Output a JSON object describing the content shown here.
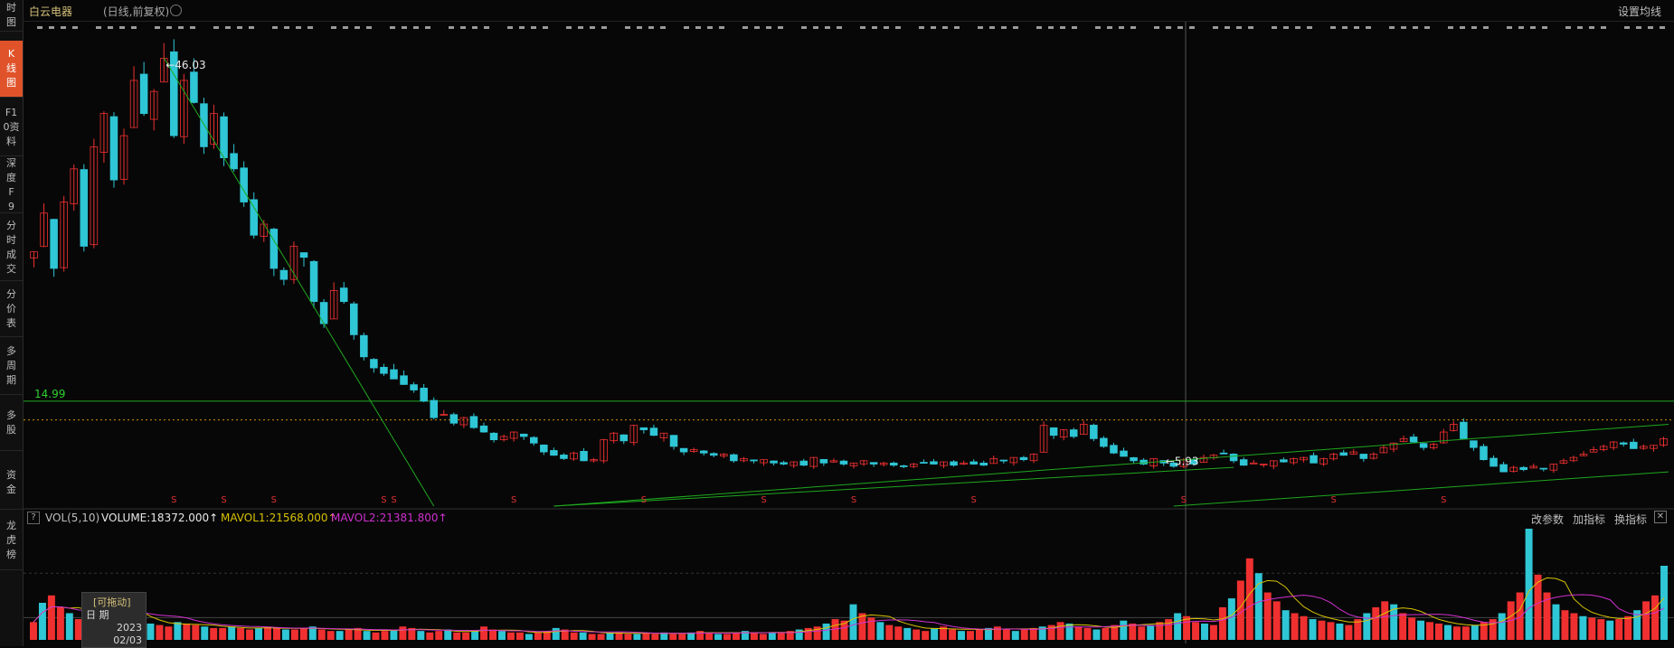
{
  "sidebar": {
    "items": [
      {
        "label": "时图",
        "active": false
      },
      {
        "label": "K线图",
        "active": true
      },
      {
        "label": "F10资料",
        "active": false
      },
      {
        "label": "深度F9",
        "active": false
      },
      {
        "label": "分时成交",
        "active": false
      },
      {
        "label": "分价表",
        "active": false
      },
      {
        "label": "多周期",
        "active": false
      },
      {
        "label": "多股",
        "active": false
      },
      {
        "label": "资金",
        "active": false
      },
      {
        "label": "龙虎榜",
        "active": false
      }
    ]
  },
  "header": {
    "title": "白云电器",
    "subtitle": "(日线,前复权)",
    "settings_label": "设置均线"
  },
  "chart_data": {
    "type": "candlestick",
    "price_annotations": {
      "high": "46.03",
      "low": "5.93",
      "level": "14.99"
    },
    "ylim_price": [
      5.5,
      48
    ],
    "price_series": [
      28.5,
      32,
      27,
      33,
      36,
      29,
      38,
      41,
      35,
      39,
      44,
      41,
      43,
      46,
      39,
      44,
      42,
      38,
      41,
      37,
      36,
      33,
      30,
      31,
      27,
      26,
      29,
      28,
      24,
      22,
      25,
      24,
      21,
      19,
      18,
      17.5,
      17,
      16.5,
      16,
      15,
      13.5,
      13.8,
      13,
      13.5,
      12.6,
      12.2,
      11.5,
      11.8,
      12.2,
      11.8,
      11.2,
      10.4,
      10.1,
      9.8,
      10.3,
      9.6,
      9.7,
      11.5,
      12.1,
      11.4,
      12.8,
      12.4,
      11.9,
      12.1,
      10.9,
      10.4,
      10.6,
      10.3,
      10.1,
      10.2,
      9.6,
      9.8,
      9.6,
      9.7,
      9.4,
      9.3,
      9.5,
      9.2,
      9.9,
      9.4,
      9.6,
      9.3,
      9.4,
      9.6,
      9.3,
      9.4,
      9.2,
      9.1,
      9.3,
      9.4,
      9.3,
      9.5,
      9.2,
      9.4,
      9.3,
      9.2,
      9.8,
      9.6,
      9.9,
      9.7,
      10.2,
      12.8,
      11.9,
      12.4,
      11.8,
      12.9,
      11.6,
      10.9,
      10.3,
      10.0,
      9.6,
      9.3,
      9.8,
      9.4,
      9.1,
      9.7,
      9.3,
      9.9,
      10.1,
      10.3,
      9.6,
      9.2,
      9.4,
      9.3,
      9.6,
      9.5,
      9.8,
      9.9,
      9.4,
      9.8,
      10.2,
      10.1,
      10.4,
      9.8,
      10.2,
      10.8,
      11.2,
      11.6,
      11.3,
      10.8,
      11.1,
      12.2,
      12.9,
      11.6,
      10.8,
      9.7,
      9.1,
      8.6,
      9.0,
      8.8,
      9.1,
      8.9,
      9.3,
      9.6,
      9.9,
      10.2,
      10.6,
      10.9,
      11.3,
      11.1,
      10.7,
      10.9,
      11.0,
      11.6
    ],
    "price_low_idx": 113,
    "volume_series": [
      12,
      25,
      30,
      22,
      18,
      14,
      16,
      20,
      28,
      22,
      18,
      15,
      13,
      11,
      10,
      9,
      12,
      11,
      10,
      9,
      8,
      8,
      9,
      8,
      7,
      8,
      9,
      8,
      7,
      7,
      8,
      9,
      7,
      6,
      6,
      7,
      8,
      6,
      5,
      6,
      7,
      9,
      8,
      6,
      5,
      6,
      7,
      5,
      5,
      6,
      9,
      7,
      6,
      5,
      5,
      4,
      5,
      6,
      8,
      7,
      5,
      5,
      4,
      4,
      5,
      5,
      4,
      4,
      5,
      4,
      5,
      4,
      4,
      5,
      6,
      5,
      4,
      4,
      5,
      6,
      5,
      4,
      5,
      5,
      6,
      7,
      8,
      9,
      11,
      14,
      13,
      24,
      18,
      15,
      12,
      10,
      9,
      8,
      7,
      6,
      8,
      9,
      7,
      6,
      6,
      7,
      8,
      9,
      7,
      6,
      7,
      8,
      9,
      10,
      12,
      11,
      9,
      8,
      7,
      8,
      10,
      13,
      11,
      9,
      10,
      12,
      14,
      18,
      16,
      12,
      11,
      10,
      22,
      28,
      40,
      55,
      45,
      32,
      26,
      20,
      18,
      16,
      14,
      13,
      12,
      11,
      10,
      14,
      18,
      22,
      26,
      24,
      18,
      15,
      13,
      12,
      11,
      10,
      9,
      9,
      10,
      12,
      14,
      18,
      26,
      32,
      75,
      44,
      32,
      24,
      20,
      18,
      16,
      15,
      14,
      13,
      14,
      16,
      20,
      26,
      30,
      50
    ]
  },
  "volume_panel": {
    "label": "VOL(5,10)",
    "volume_text": "VOLUME:18372.000↑",
    "mavol1_text": "MAVOL1:21568.000↑",
    "mavol2_text": "MAVOL2:21381.800↑",
    "btn_params": "改参数",
    "btn_add": "加指标",
    "btn_switch": "换指标"
  },
  "drag_box": {
    "title": "[可拖动]",
    "date_label": "日  期",
    "year": "2023",
    "date": "02/03"
  },
  "colors": {
    "up": "#f03030",
    "down": "#2fc6d6",
    "trend": "#1ea81e",
    "mavol1": "#d8c200",
    "mavol2": "#d030d0",
    "dotted": "#d29100"
  }
}
